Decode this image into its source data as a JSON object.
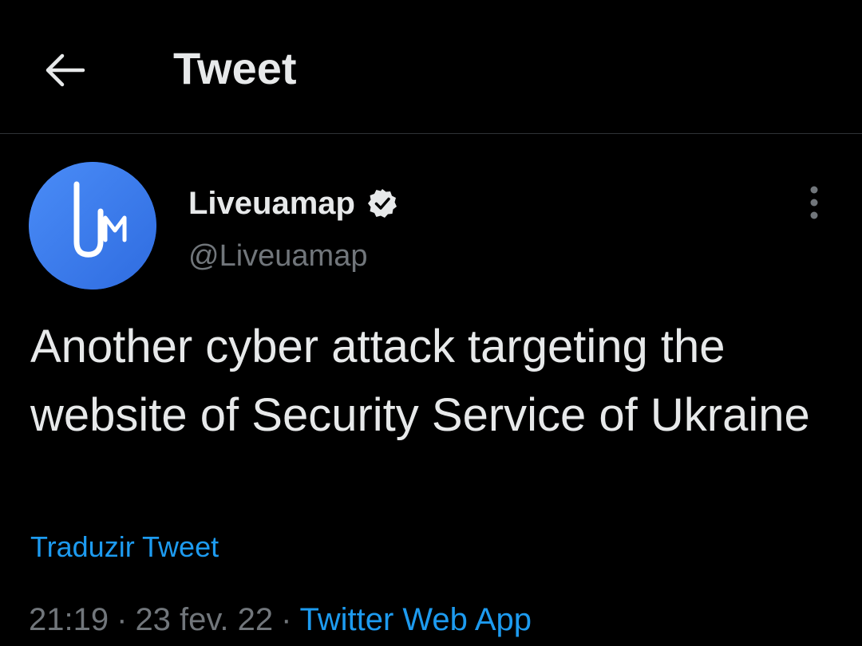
{
  "header": {
    "title": "Tweet",
    "back_icon": "arrow-left-icon"
  },
  "author": {
    "display_name": "Liveuamap",
    "handle": "@Liveuamap",
    "verified": true,
    "avatar_icon": "liveuamap-logo",
    "avatar_color": "#3b7cf2"
  },
  "tweet": {
    "text": "Another cyber attack targeting the website of Security Service of Ukraine",
    "translate_label": "Traduzir Tweet",
    "time": "21:19",
    "separator": "·",
    "date": "23 fev. 22",
    "source": "Twitter Web App"
  },
  "colors": {
    "background": "#000000",
    "text_primary": "#e7e9ea",
    "text_secondary": "#71767b",
    "link": "#1d9bf0",
    "divider": "#2f3336"
  }
}
